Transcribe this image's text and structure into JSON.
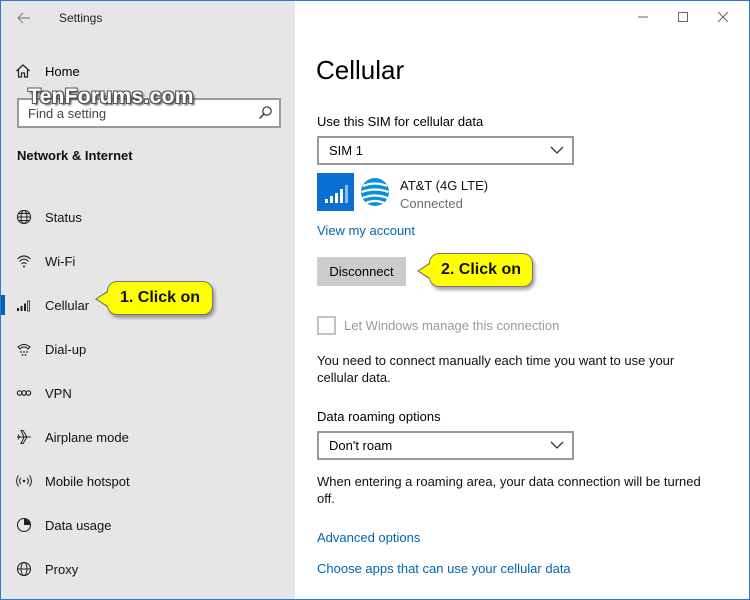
{
  "window": {
    "app_title": "Settings"
  },
  "sidebar": {
    "home_label": "Home",
    "watermark": "TenForums.com",
    "search": {
      "placeholder": "Find a setting"
    },
    "section_title": "Network & Internet",
    "items": [
      {
        "label": "Status",
        "icon": "globe-icon"
      },
      {
        "label": "Wi-Fi",
        "icon": "wifi-icon"
      },
      {
        "label": "Cellular",
        "icon": "cellular-signal-icon",
        "active": true
      },
      {
        "label": "Dial-up",
        "icon": "dialup-icon"
      },
      {
        "label": "VPN",
        "icon": "vpn-icon"
      },
      {
        "label": "Airplane mode",
        "icon": "airplane-icon"
      },
      {
        "label": "Mobile hotspot",
        "icon": "hotspot-icon"
      },
      {
        "label": "Data usage",
        "icon": "data-usage-icon"
      },
      {
        "label": "Proxy",
        "icon": "globe-icon"
      }
    ]
  },
  "main": {
    "title": "Cellular",
    "sim_label": "Use this SIM for cellular data",
    "sim_value": "SIM 1",
    "network": {
      "name": "AT&T (4G LTE)",
      "status": "Connected"
    },
    "view_account_link": "View my account",
    "disconnect_button": "Disconnect",
    "manage_checkbox_label": "Let Windows manage this connection",
    "manual_note": "You need to connect manually each time you want to use your cellular data.",
    "roaming_label": "Data roaming options",
    "roaming_value": "Don't roam",
    "roaming_note": "When entering a roaming area, your data connection will be turned off.",
    "advanced_link": "Advanced options",
    "apps_link": "Choose apps that can use your cellular data"
  },
  "callouts": {
    "step1": "1. Click on",
    "step2": "2. Click on"
  },
  "colors": {
    "accent": "#0063b1",
    "link": "#0066b4",
    "callout": "#ffff00",
    "sidebar_bg": "#e6e6e6",
    "tile_blue": "#0a6fd2"
  }
}
